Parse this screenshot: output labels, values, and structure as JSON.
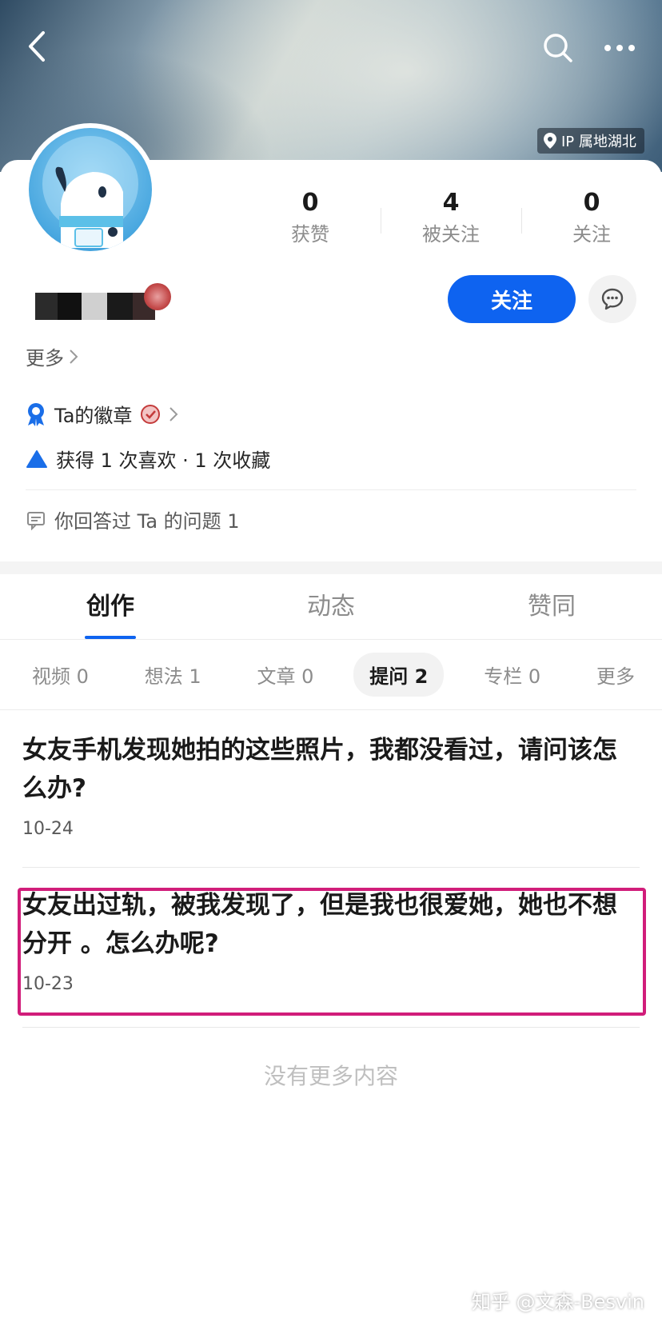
{
  "header": {
    "ip_location": "IP 属地湖北"
  },
  "stats": [
    {
      "value": "0",
      "label": "获赞"
    },
    {
      "value": "4",
      "label": "被关注"
    },
    {
      "value": "0",
      "label": "关注"
    }
  ],
  "profile": {
    "follow_label": "关注",
    "more_label": "更多",
    "badge_label": "Ta的徽章",
    "likes_text": "获得 1 次喜欢 · 1 次收藏",
    "answered_text": "你回答过 Ta 的问题 1"
  },
  "main_tabs": [
    "创作",
    "动态",
    "赞同"
  ],
  "sub_tabs": [
    "视频 0",
    "想法 1",
    "文章 0",
    "提问 2",
    "专栏 0",
    "更多"
  ],
  "questions": [
    {
      "title": "女友手机发现她拍的这些照片，我都没看过，请问该怎么办?",
      "date": "10-24"
    },
    {
      "title": "女友出过轨，被我发现了，但是我也很爱她，她也不想分开 。怎么办呢?",
      "date": "10-23"
    }
  ],
  "footer": {
    "no_more": "没有更多内容",
    "watermark": "知乎 @文森-Besvin"
  },
  "colors": {
    "accent": "#0e63f0",
    "highlight_frame": "#d11d7a"
  }
}
